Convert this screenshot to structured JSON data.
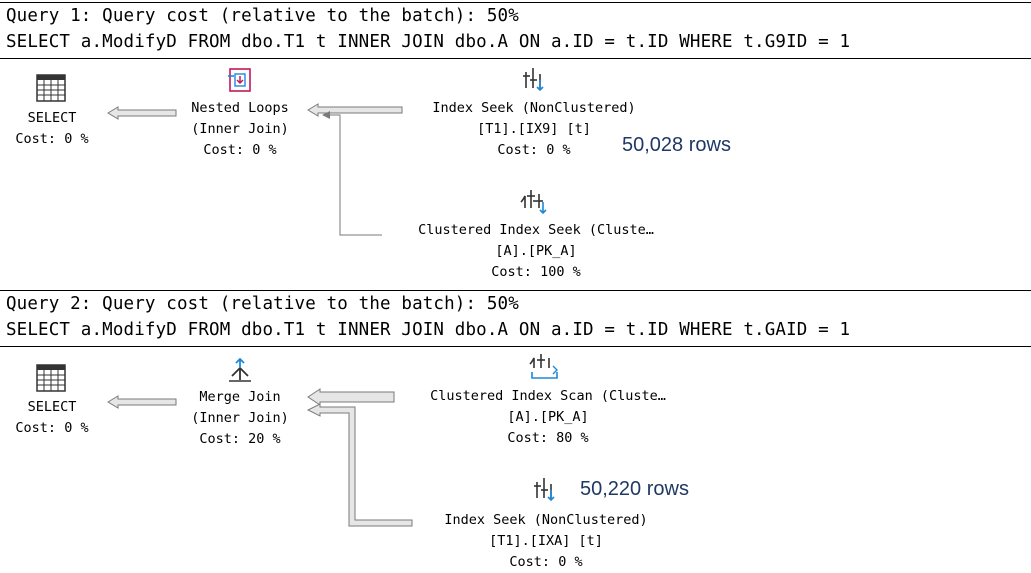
{
  "query1": {
    "title": "Query 1: Query cost (relative to the batch): 50%",
    "sql": "SELECT a.ModifyD FROM dbo.T1 t INNER JOIN dbo.A ON a.ID = t.ID WHERE t.G9ID = 1",
    "select": {
      "name": "SELECT",
      "cost": "Cost: 0 %",
      "icon": "select-icon"
    },
    "join": {
      "name": "Nested Loops",
      "type": "(Inner Join)",
      "cost": "Cost: 0 %",
      "icon": "nested-loops-icon"
    },
    "seek_top": {
      "name": "Index Seek (NonClustered)",
      "object": "[T1].[IX9] [t]",
      "cost": "Cost: 0 %",
      "icon": "index-seek-icon"
    },
    "seek_bottom": {
      "name": "Clustered Index Seek (Cluste…",
      "object": "[A].[PK_A]",
      "cost": "Cost: 100 %",
      "icon": "clustered-index-seek-icon"
    },
    "rows_note": "50,028 rows"
  },
  "query2": {
    "title": "Query 2: Query cost (relative to the batch): 50%",
    "sql": "SELECT a.ModifyD FROM dbo.T1 t INNER JOIN dbo.A ON a.ID = t.ID WHERE t.GAID = 1",
    "select": {
      "name": "SELECT",
      "cost": "Cost: 0 %",
      "icon": "select-icon"
    },
    "join": {
      "name": "Merge Join",
      "type": "(Inner Join)",
      "cost": "Cost: 20 %",
      "icon": "merge-join-icon"
    },
    "scan_top": {
      "name": "Clustered Index Scan (Cluste…",
      "object": "[A].[PK_A]",
      "cost": "Cost: 80 %",
      "icon": "clustered-index-scan-icon"
    },
    "seek_bottom": {
      "name": "Index Seek (NonClustered)",
      "object": "[T1].[IXA] [t]",
      "cost": "Cost: 0 %",
      "icon": "index-seek-icon"
    },
    "rows_note": "50,220 rows"
  },
  "colors": {
    "note_text": "#1f3864",
    "icon_blue": "#1e88d6",
    "icon_magenta": "#c2185b",
    "arrow_fill": "#e6e6e6",
    "arrow_stroke": "#7a7a7a"
  }
}
